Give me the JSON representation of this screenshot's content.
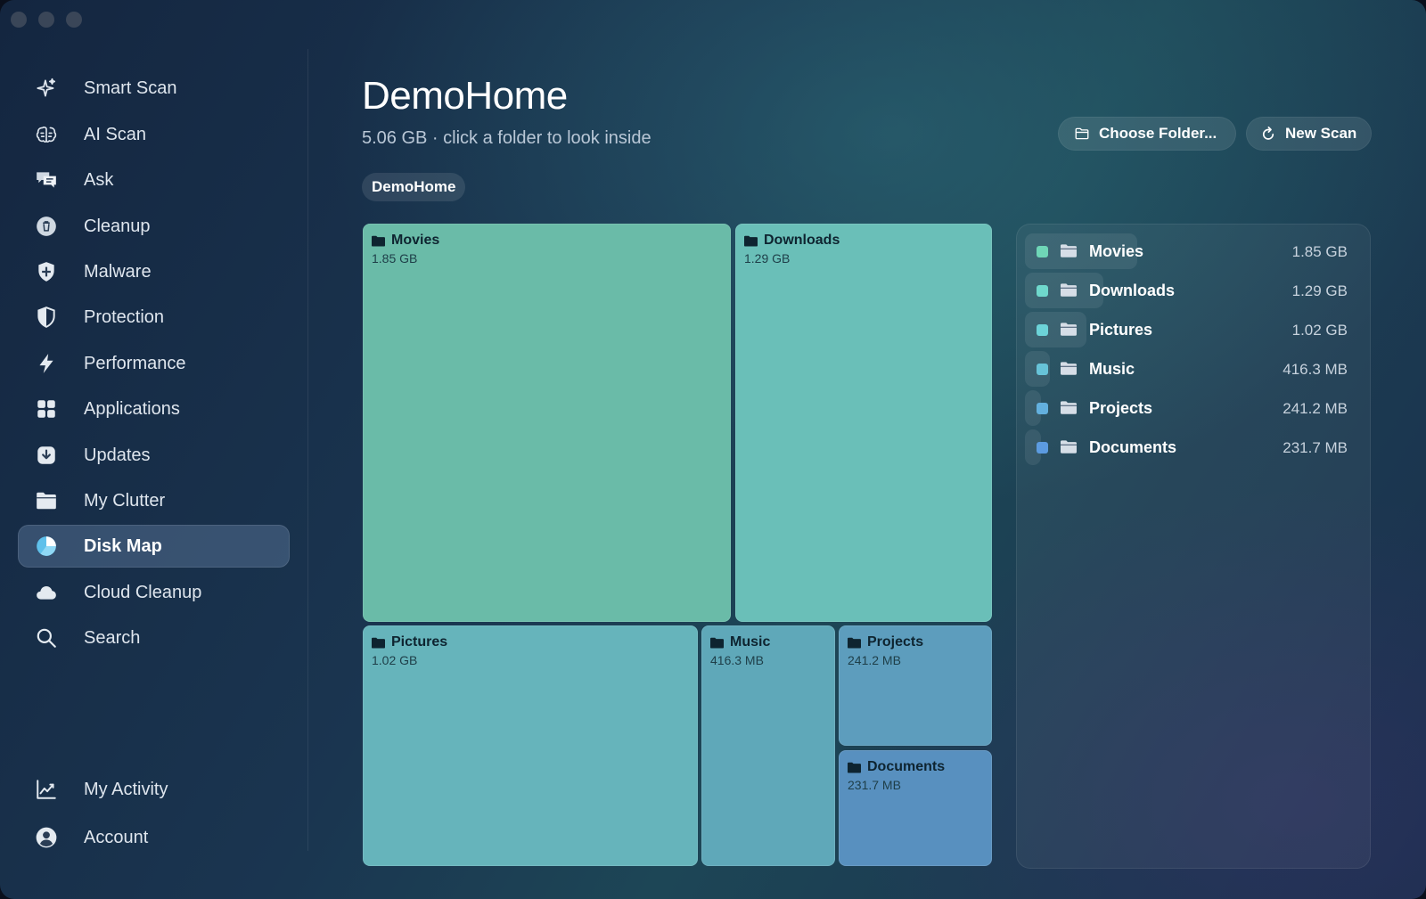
{
  "window": {
    "traffic_lights": [
      "close",
      "minimize",
      "zoom"
    ]
  },
  "sidebar": {
    "items": [
      {
        "label": "Smart Scan",
        "icon": "sparkles-icon"
      },
      {
        "label": "AI Scan",
        "icon": "brain-icon"
      },
      {
        "label": "Ask",
        "icon": "chat-bubbles-icon"
      },
      {
        "label": "Cleanup",
        "icon": "trash-icon"
      },
      {
        "label": "Malware",
        "icon": "shield-icon"
      },
      {
        "label": "Protection",
        "icon": "half-shield-icon"
      },
      {
        "label": "Performance",
        "icon": "bolt-icon"
      },
      {
        "label": "Applications",
        "icon": "grid-icon"
      },
      {
        "label": "Updates",
        "icon": "download-icon"
      },
      {
        "label": "My Clutter",
        "icon": "folder-icon"
      },
      {
        "label": "Disk Map",
        "icon": "pie-chart-icon",
        "active": true
      },
      {
        "label": "Cloud Cleanup",
        "icon": "cloud-icon"
      },
      {
        "label": "Search",
        "icon": "magnifier-icon"
      }
    ],
    "footer": [
      {
        "label": "My Activity",
        "icon": "line-chart-icon"
      },
      {
        "label": "Account",
        "icon": "person-icon"
      }
    ]
  },
  "header": {
    "title": "DemoHome",
    "subtitle": "5.06 GB · click a folder to look inside",
    "breadcrumb": "DemoHome",
    "choose_folder_label": "Choose Folder...",
    "new_scan_label": "New Scan"
  },
  "folders": [
    {
      "name": "Movies",
      "size": "1.85 GB",
      "color": "#6abba8"
    },
    {
      "name": "Downloads",
      "size": "1.29 GB",
      "color": "#6abfb8"
    },
    {
      "name": "Pictures",
      "size": "1.02 GB",
      "color": "#66b4bb"
    },
    {
      "name": "Music",
      "size": "416.3 MB",
      "color": "#5fa8b9"
    },
    {
      "name": "Projects",
      "size": "241.2 MB",
      "color": "#5d9dbd"
    },
    {
      "name": "Documents",
      "size": "231.7 MB",
      "color": "#5890bf"
    }
  ],
  "folder_list": {
    "dot_colors": [
      "#6fd6b7",
      "#6fd8cc",
      "#6cd3d8",
      "#67c3d8",
      "#63b0de",
      "#5c9be0"
    ],
    "share_of_largest": [
      1.0,
      0.697,
      0.551,
      0.22,
      0.127,
      0.122
    ]
  }
}
